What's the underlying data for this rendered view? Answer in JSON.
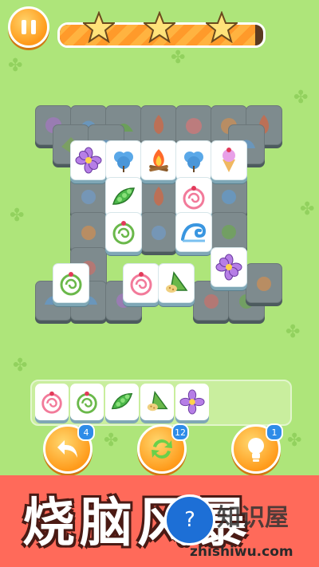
{
  "hud": {
    "progress_fraction": 0.96,
    "stars_earned": 3
  },
  "tray": {
    "items": [
      "cake-roll-pink",
      "cake-roll-green",
      "pea-pod",
      "zongzi",
      "purple-flower"
    ]
  },
  "buttons": {
    "undo": {
      "icon": "undo-arrow-icon",
      "count": "4"
    },
    "shuffle": {
      "icon": "shuffle-arrows-icon",
      "count": "12"
    },
    "hint": {
      "icon": "lightbulb-icon",
      "count": "1"
    }
  },
  "banner": {
    "title": "烧脑风暴"
  },
  "watermark": {
    "site": "zhishiwu.com",
    "brand": "知识屋",
    "icon": "question-monitor-icon"
  },
  "colors": {
    "background": "#aee57a",
    "banner": "#ff6a5a",
    "accent": "#ff9a1a",
    "badge": "#2e8ce8"
  }
}
